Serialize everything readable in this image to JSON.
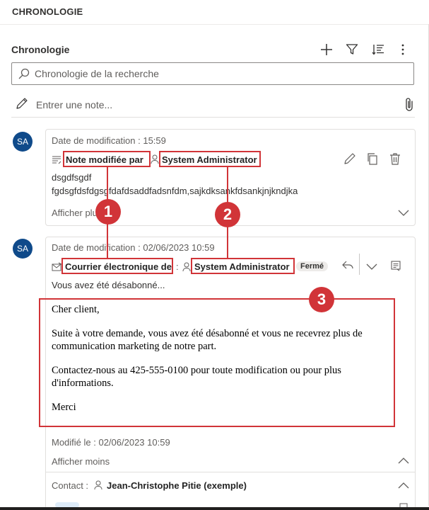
{
  "section": {
    "header": "CHRONOLOGIE"
  },
  "timeline": {
    "title": "Chronologie",
    "search_placeholder": "Chronologie de la recherche",
    "note_placeholder": "Entrer une note..."
  },
  "toolbar": {
    "add_icon": "plus-icon",
    "filter_icon": "filter-icon",
    "sort_icon": "sort-icon",
    "more_icon": "more-vertical-icon"
  },
  "entries": [
    {
      "avatar": "SA",
      "modified": "Date de modification : 15:59",
      "title": "Note modifiée par",
      "author": "System Administrator",
      "body_line1": "dsgdfsgdf",
      "body_line2": "fgdsgfdsfdgsgfdafdsaddfadsnfdm,sajkdksankfdsankjnjkndjka",
      "show_more": "Afficher plus"
    },
    {
      "avatar": "SA",
      "modified": "Date de modification : 02/06/2023 10:59",
      "title": "Courrier électronique de",
      "separator": ":",
      "author": "System Administrator",
      "status": "Fermé",
      "preview": "Vous avez été désabonné...",
      "email_body": [
        "Cher client,",
        "Suite à votre demande, vous avez été désabonné et vous ne recevrez plus de communication marketing de notre part.",
        "Contactez-nous au 425-555-0100 pour toute modification ou pour plus d'informations.",
        "Merci"
      ],
      "modified_on": "Modifié le : 02/06/2023 10:59",
      "show_less": "Afficher moins",
      "contact_label": "Contact :",
      "contact_name": "Jean-Christophe Pitie (exemple)"
    }
  ],
  "callouts": [
    "1",
    "2",
    "3"
  ],
  "colors": {
    "accent": "#0f4a8a",
    "callout": "#d13438"
  }
}
